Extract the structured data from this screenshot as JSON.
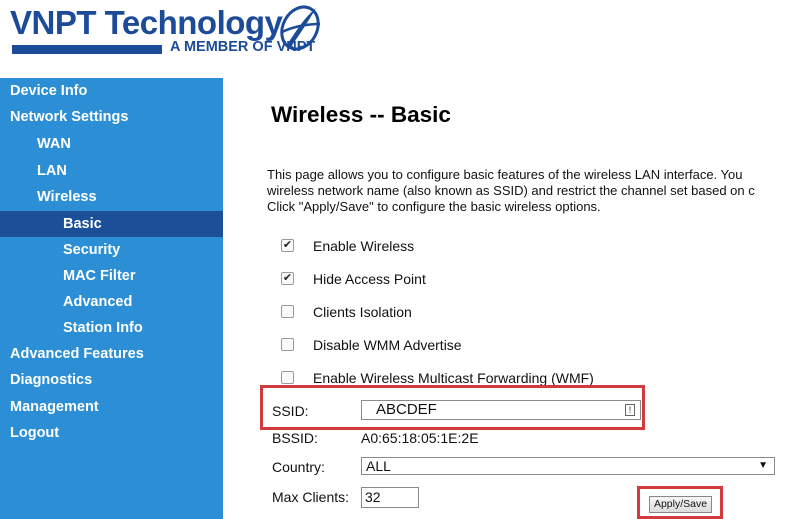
{
  "brand": {
    "title": "VNPT Technology",
    "subtitle": "A MEMBER OF VNPT",
    "color": "#1c4c99"
  },
  "sidebar": {
    "color": "#2c8fd5",
    "active_color": "#1b4f97",
    "items": [
      {
        "label": "Device Info"
      },
      {
        "label": "Network Settings"
      },
      {
        "label": "WAN"
      },
      {
        "label": "LAN"
      },
      {
        "label": "Wireless"
      },
      {
        "label": "Basic"
      },
      {
        "label": "Security"
      },
      {
        "label": "MAC Filter"
      },
      {
        "label": "Advanced"
      },
      {
        "label": "Station Info"
      },
      {
        "label": "Advanced Features"
      },
      {
        "label": "Diagnostics"
      },
      {
        "label": "Management"
      },
      {
        "label": "Logout"
      }
    ]
  },
  "main": {
    "title": "Wireless -- Basic",
    "description": [
      "This page allows you to configure basic features of the wireless LAN interface. You",
      "wireless network name (also known as SSID) and restrict the channel set based on c",
      "Click \"Apply/Save\" to configure the basic wireless options."
    ],
    "checkboxes": [
      {
        "label": "Enable Wireless",
        "checked": true
      },
      {
        "label": "Hide Access Point",
        "checked": true
      },
      {
        "label": "Clients Isolation",
        "checked": false
      },
      {
        "label": "Disable WMM Advertise",
        "checked": false
      },
      {
        "label": "Enable Wireless Multicast Forwarding (WMF)",
        "checked": false
      }
    ],
    "ssid": {
      "label": "SSID:",
      "value": "ABCDEF"
    },
    "bssid": {
      "label": "BSSID:",
      "value": "A0:65:18:05:1E:2E"
    },
    "country": {
      "label": "Country:",
      "value": "ALL"
    },
    "max_clients": {
      "label": "Max Clients:",
      "value": "32"
    },
    "apply_button": "Apply/Save",
    "highlight_color": "#d23b3b"
  }
}
